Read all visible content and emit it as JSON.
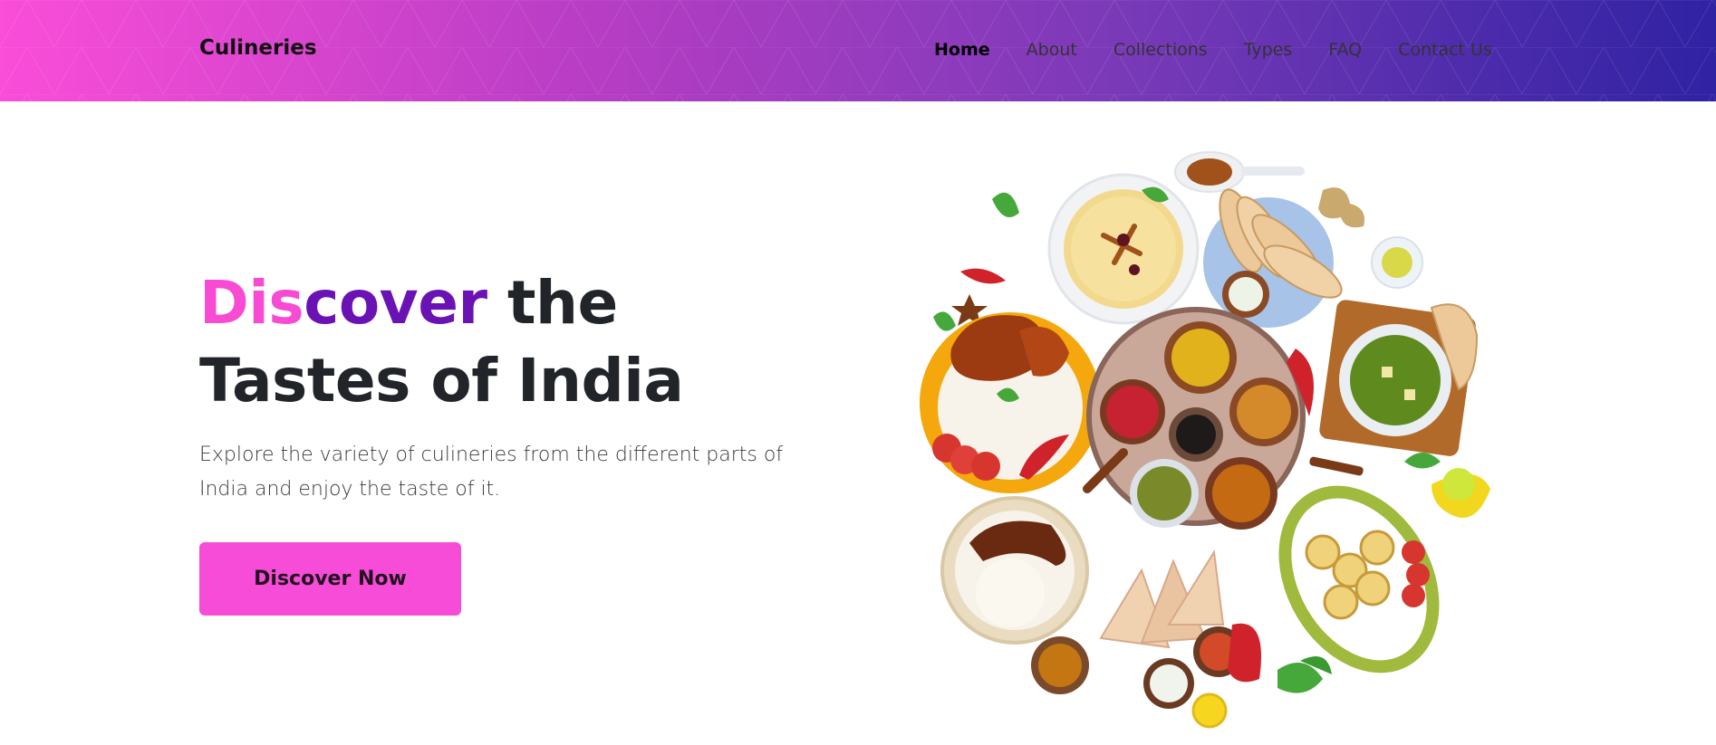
{
  "nav": {
    "brand": "Culineries",
    "links": [
      {
        "label": "Home",
        "active": true
      },
      {
        "label": "About",
        "active": false
      },
      {
        "label": "Collections",
        "active": false
      },
      {
        "label": "Types",
        "active": false
      },
      {
        "label": "FAQ",
        "active": false
      },
      {
        "label": "Contact Us",
        "active": false
      }
    ]
  },
  "hero": {
    "title_part1": "Dis",
    "title_part2": "cover",
    "title_rest": " the Tastes of India",
    "subtitle": "Explore the variety of culineries from the different parts of India and enjoy the taste of it.",
    "cta_label": "Discover Now"
  },
  "colors": {
    "nav_gradient_start": "#fa4dd8",
    "nav_gradient_end": "#2f22a3",
    "accent_pink": "#f64bd2",
    "accent_purple": "#6a12b4",
    "cta_background": "#f74cd7",
    "text_dark": "#212529"
  }
}
